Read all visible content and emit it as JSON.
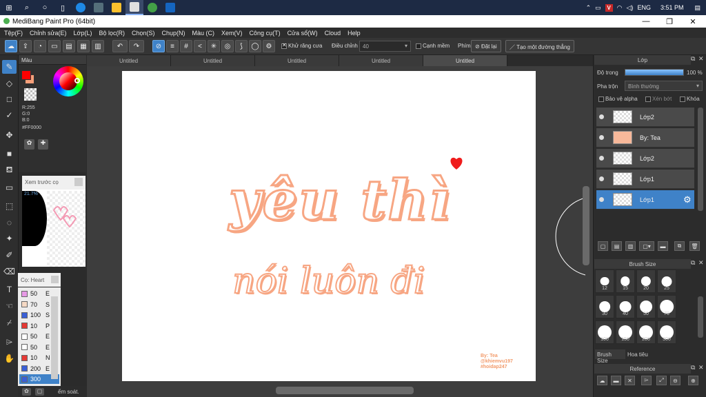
{
  "taskbar": {
    "lang": "ENG",
    "time": "3:51 PM"
  },
  "window": {
    "title": "MediBang Paint Pro (64bit)"
  },
  "menu": [
    "Tệp(F)",
    "Chỉnh sửa(E)",
    "Lớp(L)",
    "Bộ lọc(R)",
    "Chọn(S)",
    "Chụp(N)",
    "Màu (C)",
    "Xem(V)",
    "Công cụ(T)",
    "Cửa sổ(W)",
    "Cloud",
    "Help"
  ],
  "toolbar": {
    "antialias_label": "Khử răng cưa",
    "adjust_label": "Điều chỉnh",
    "adjust_value": "40",
    "edge_label": "Cạnh mềm",
    "key_label": "Phím",
    "reset_label": "Đặt lại",
    "straight_label": "Tạo một đường thẳng"
  },
  "color_panel": {
    "title": "Màu",
    "r": "R:255",
    "g": "G:0",
    "b": "B:0",
    "hex": "#FF0000",
    "primary": "#ff0000",
    "secondary": "#f7a07a"
  },
  "preview": {
    "title": "Xem trước cọ",
    "zoom": "21.7%"
  },
  "brush_panel": {
    "title": "Cọ: Heart",
    "rows": [
      {
        "size": "50",
        "tag": "E",
        "color": "#e79ae6"
      },
      {
        "size": "70",
        "tag": "S",
        "color": "#f5d9c4"
      },
      {
        "size": "100",
        "tag": "S",
        "color": "#3a5fd6"
      },
      {
        "size": "10",
        "tag": "P",
        "color": "#e53935"
      },
      {
        "size": "50",
        "tag": "E",
        "color": "#ffffff"
      },
      {
        "size": "50",
        "tag": "E",
        "color": "#ffffff"
      },
      {
        "size": "10",
        "tag": "N",
        "color": "#e53935"
      },
      {
        "size": "200",
        "tag": "E",
        "color": "#3a5fd6"
      },
      {
        "size": "300",
        "tag": "",
        "color": "#3a5fd6"
      }
    ],
    "footer": "ểm soát."
  },
  "tabs": [
    "Untitled",
    "Untitled",
    "Untitled",
    "Untitled",
    "Untitled"
  ],
  "canvas": {
    "line1": "yêu thì",
    "line2": "nói luôn đi",
    "credit1": "By: Tea",
    "credit2": "@khiemvu197",
    "credit3": "#hoidap247",
    "text_color": "#f7a683"
  },
  "layer_panel": {
    "title": "Lớp",
    "opacity_label": "Độ trong",
    "opacity_value": "100 %",
    "opacity": 100,
    "blend_label": "Pha trộn",
    "blend_value": "Bình thường",
    "protect_alpha": "Bảo vệ alpha",
    "clipping": "Xén bớt",
    "lock": "Khóa",
    "layers": [
      {
        "name": "Lớp2"
      },
      {
        "name": "By: Tea"
      },
      {
        "name": "Lớp2"
      },
      {
        "name": "Lớp1"
      },
      {
        "name": "Lớp1"
      }
    ]
  },
  "brush_size_panel": {
    "title": "Brush Size",
    "sizes": [
      "12",
      "15",
      "20",
      "25",
      "30",
      "40",
      "50",
      "70",
      "100",
      "150",
      "200",
      "300"
    ],
    "tab1": "Brush Size",
    "tab2": "Hoa tiêu"
  },
  "reference_panel": {
    "title": "Reference"
  }
}
